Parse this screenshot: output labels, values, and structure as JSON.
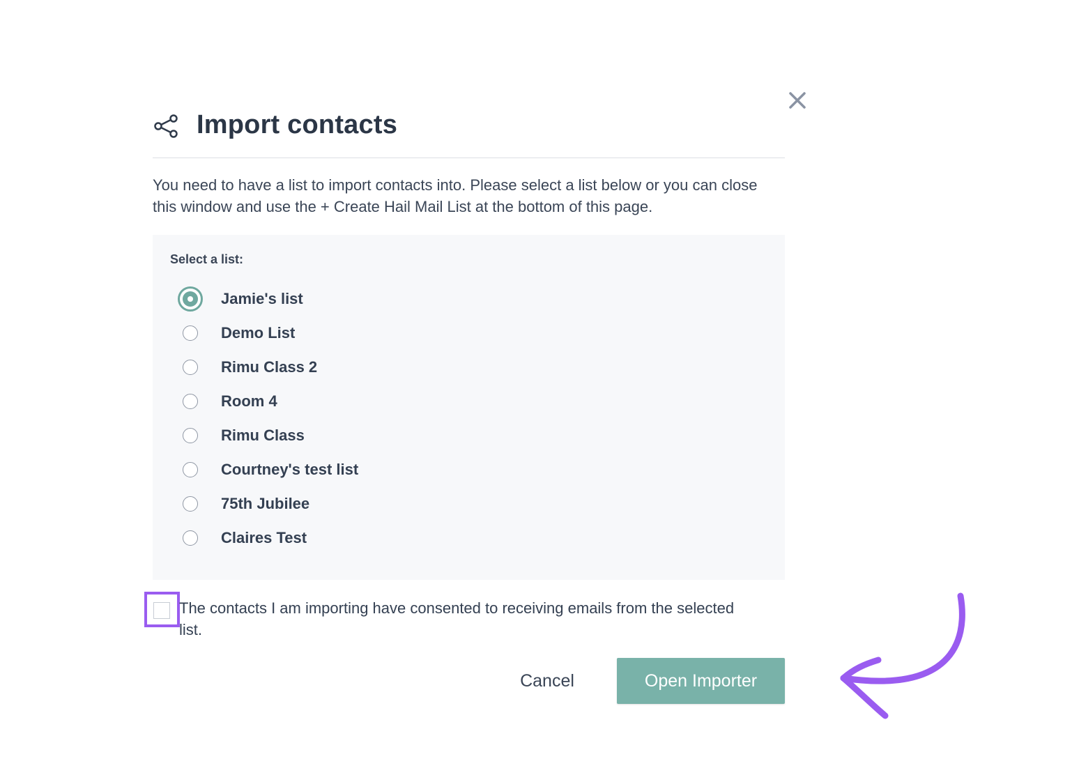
{
  "dialog": {
    "title": "Import contacts",
    "description": "You need to have a list to import contacts into. Please select a list below or you can close this window and use the + Create Hail Mail List at the bottom of this page.",
    "select_label": "Select a list:",
    "lists": [
      {
        "label": "Jamie's list",
        "selected": true
      },
      {
        "label": "Demo List",
        "selected": false
      },
      {
        "label": "Rimu Class 2",
        "selected": false
      },
      {
        "label": "Room 4",
        "selected": false
      },
      {
        "label": "Rimu Class",
        "selected": false
      },
      {
        "label": "Courtney's test list",
        "selected": false
      },
      {
        "label": "75th Jubilee",
        "selected": false
      },
      {
        "label": "Claires Test",
        "selected": false
      }
    ],
    "consent_text": "The contacts I am importing have consented to receiving emails from the selected list.",
    "consent_checked": false,
    "cancel_label": "Cancel",
    "open_label": "Open Importer"
  },
  "icons": {
    "header": "share-icon",
    "close": "close-icon",
    "annotation": "curved-arrow-icon"
  },
  "colors": {
    "accent": "#79b2a9",
    "radio_selected": "#6fa89f",
    "highlight": "#9a5cf0",
    "title": "#2b3646",
    "panel_bg": "#f7f8fa"
  }
}
